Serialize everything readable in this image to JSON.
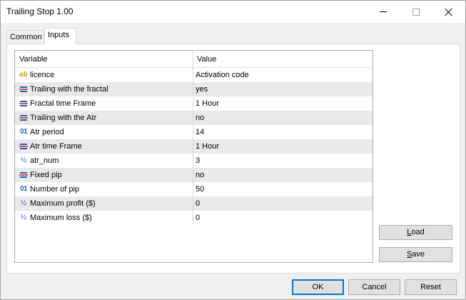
{
  "window": {
    "title": "Trailing Stop 1.00"
  },
  "tabs": [
    {
      "label": "Common"
    },
    {
      "label": "Inputs"
    }
  ],
  "table": {
    "headers": {
      "variable": "Variable",
      "value": "Value"
    },
    "rows": [
      {
        "icon": "string-icon",
        "name": "licence",
        "value": "Activation code"
      },
      {
        "icon": "enum-icon",
        "name": "Trailing with the fractal",
        "value": "yes"
      },
      {
        "icon": "enum-icon",
        "name": "Fractal time Frame",
        "value": "1 Hour"
      },
      {
        "icon": "enum-icon",
        "name": "Trailing with the Atr",
        "value": "no"
      },
      {
        "icon": "integer-icon",
        "name": "Atr period",
        "value": "14"
      },
      {
        "icon": "enum-icon",
        "name": "Atr time Frame",
        "value": "1 Hour"
      },
      {
        "icon": "double-icon",
        "name": "atr_num",
        "value": "3"
      },
      {
        "icon": "enum-icon",
        "name": "Fixed pip",
        "value": "no"
      },
      {
        "icon": "integer-icon",
        "name": "Number of pip",
        "value": "50"
      },
      {
        "icon": "double-icon",
        "name": "Maximum profit ($)",
        "value": "0"
      },
      {
        "icon": "double-icon",
        "name": "Maximum loss ($)",
        "value": "0"
      }
    ]
  },
  "icon_glyphs": {
    "string": "ab",
    "integer": "01",
    "double": "½"
  },
  "side_buttons": {
    "load": "oad",
    "load_mnemonic": "L",
    "save": "ave",
    "save_mnemonic": "S"
  },
  "footer": {
    "ok": "OK",
    "cancel": "Cancel",
    "reset": "Reset"
  },
  "colors": {
    "focus": "#0078d7",
    "row_alt": "#e9e9e9"
  }
}
